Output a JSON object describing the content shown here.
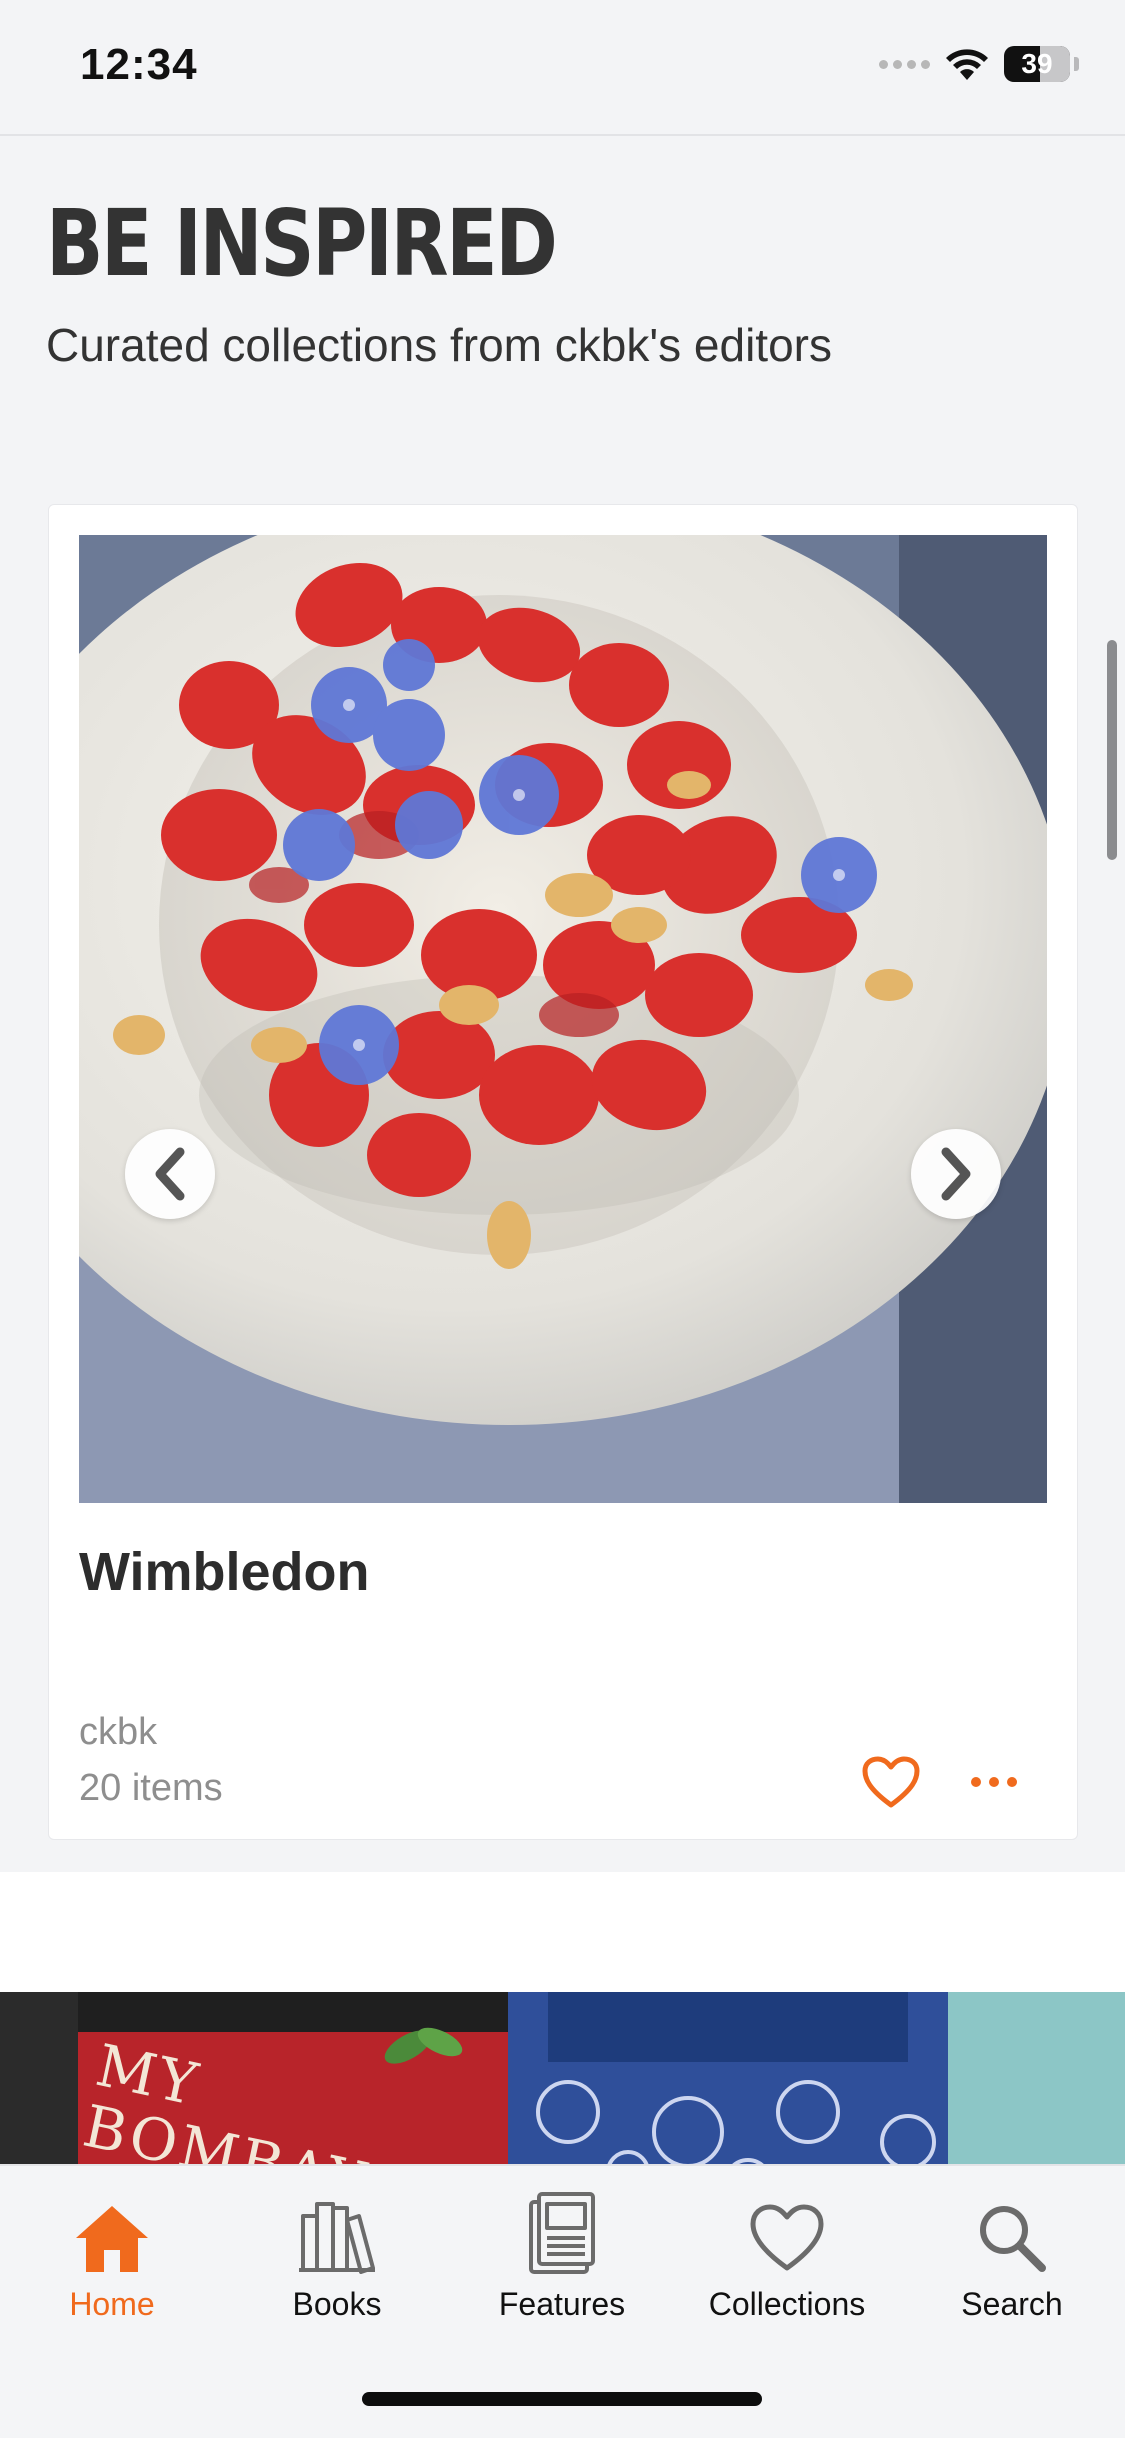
{
  "status_bar": {
    "time": "12:34",
    "battery": "39"
  },
  "header": {
    "title": "BE INSPIRED",
    "subtitle": "Curated collections from ckbk's editors"
  },
  "collection_card": {
    "title": "Wimbledon",
    "author": "ckbk",
    "item_count": "20 items",
    "image_icon": "strawberry-dish-photo",
    "prev_icon": "chevron-left-icon",
    "next_icon": "chevron-right-icon"
  },
  "books_preview": {
    "visible_title": "MY BOMBAY KITC"
  },
  "tab_bar": {
    "items": [
      {
        "label": "Home",
        "icon": "home-icon",
        "active": true
      },
      {
        "label": "Books",
        "icon": "books-icon",
        "active": false
      },
      {
        "label": "Features",
        "icon": "features-icon",
        "active": false
      },
      {
        "label": "Collections",
        "icon": "heart-icon",
        "active": false
      },
      {
        "label": "Search",
        "icon": "search-icon",
        "active": false
      }
    ]
  },
  "colors": {
    "accent": "#f06a1d",
    "text": "#2b2b2b",
    "muted": "#8e8e8e",
    "background": "#f3f4f6"
  }
}
